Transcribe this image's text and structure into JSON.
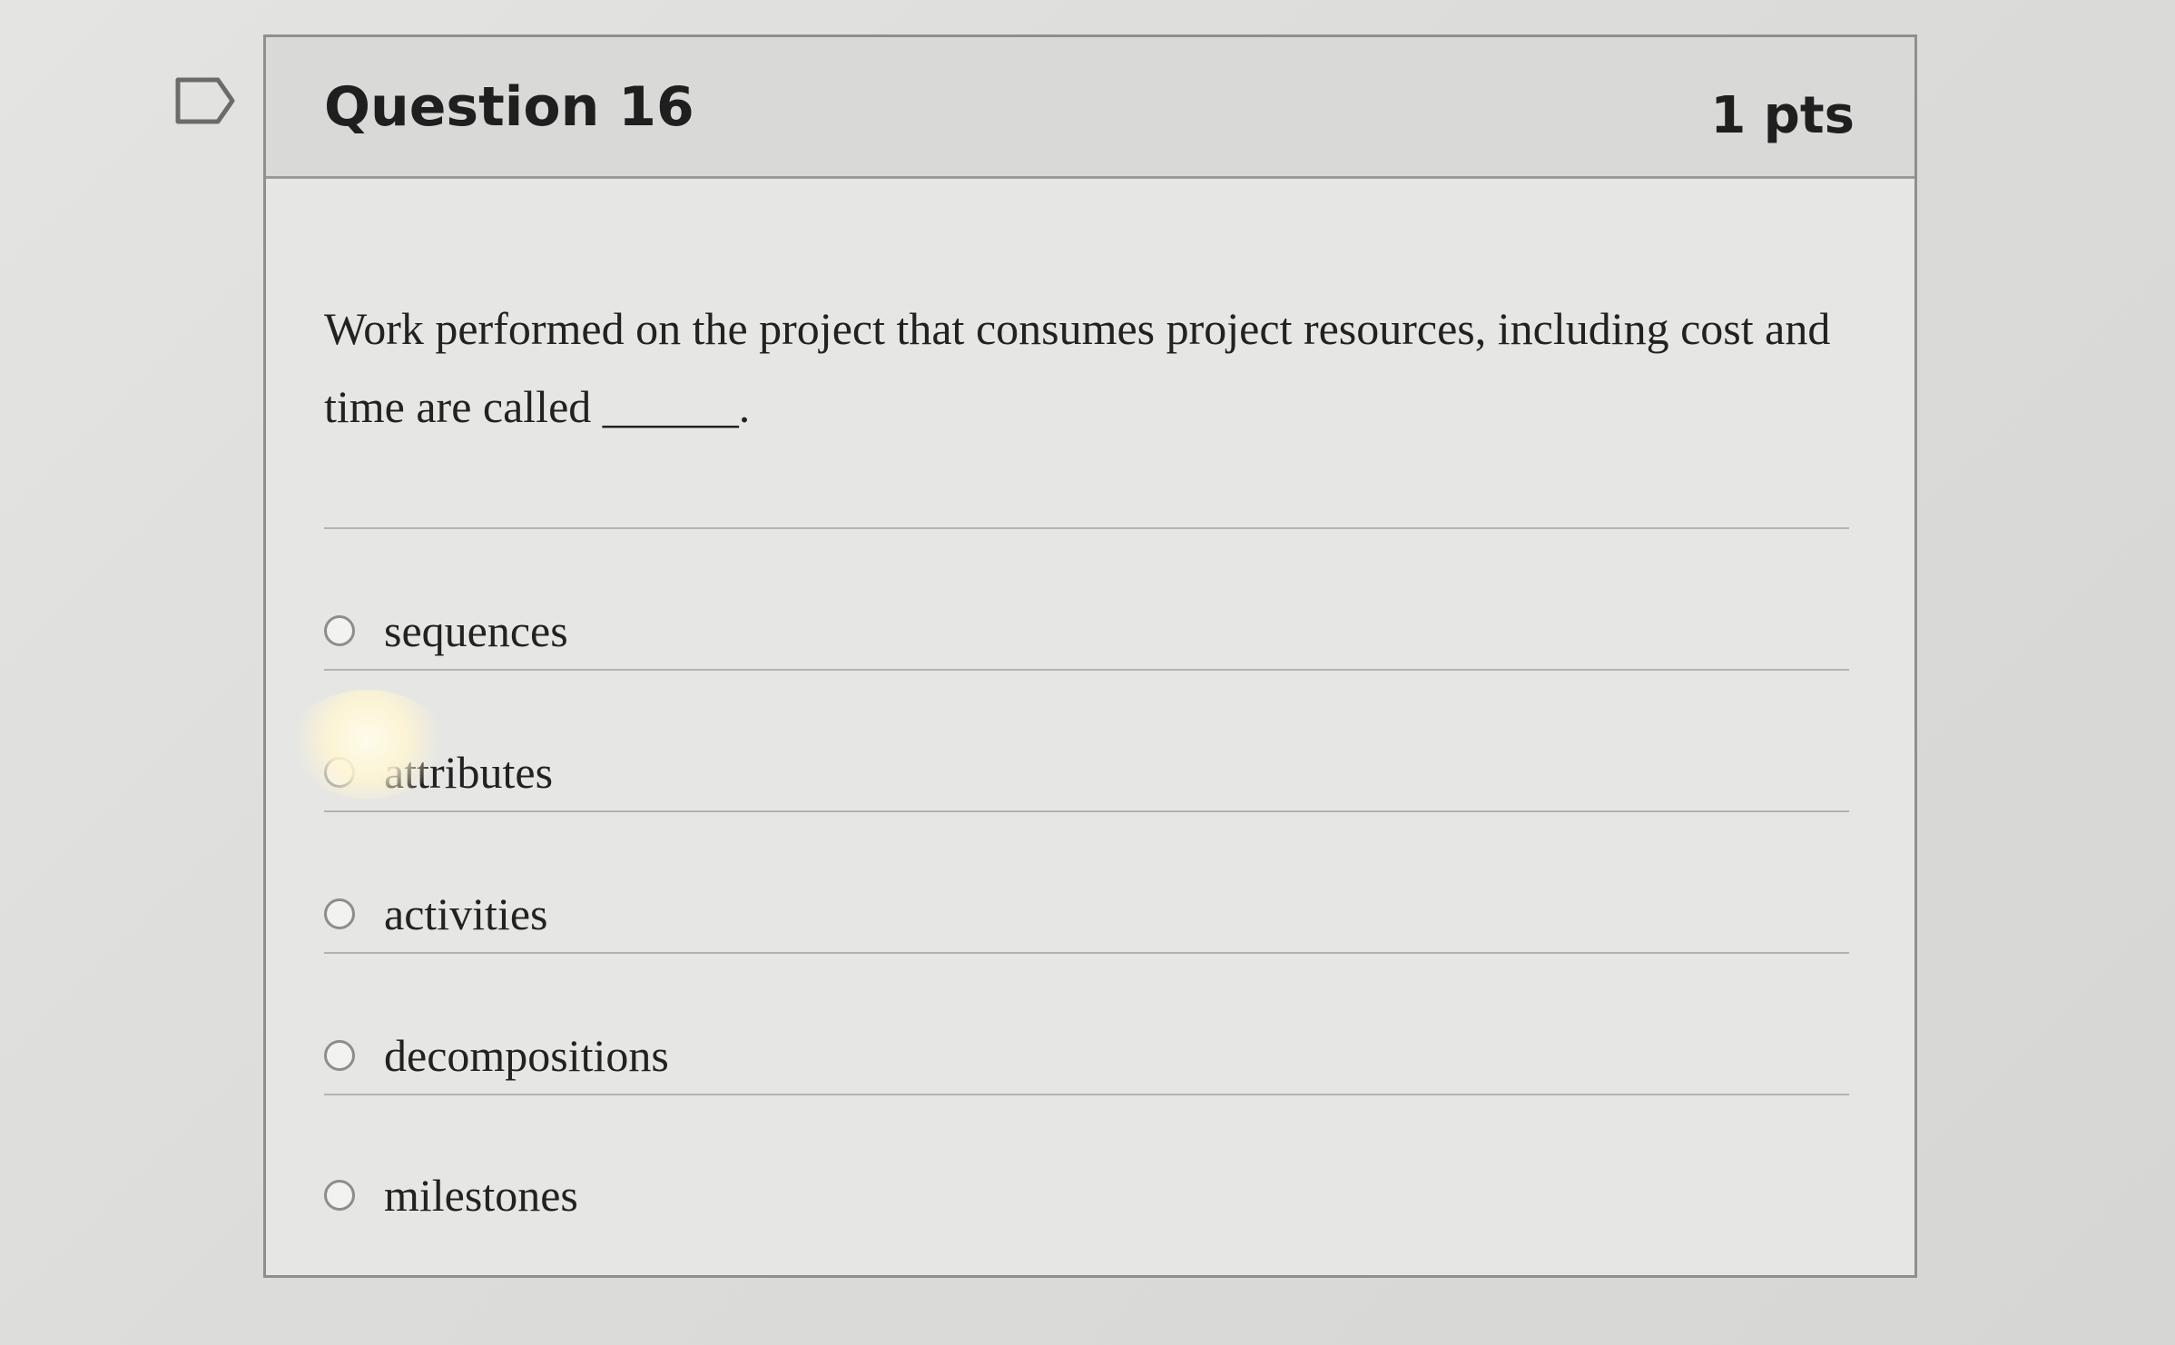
{
  "question": {
    "title": "Question 16",
    "points": "1 pts",
    "text": "Work performed on the project that consumes project resources, including cost and time are called ______."
  },
  "answers": [
    {
      "label": "sequences",
      "selected": false
    },
    {
      "label": "attributes",
      "selected": false
    },
    {
      "label": "activities",
      "selected": false
    },
    {
      "label": "decompositions",
      "selected": false
    },
    {
      "label": "milestones",
      "selected": false
    }
  ],
  "colors": {
    "background": "#dcdcda",
    "card": "#e6e6e4",
    "header": "#d9d9d7",
    "border": "#8f8f8f",
    "text": "#222222"
  }
}
